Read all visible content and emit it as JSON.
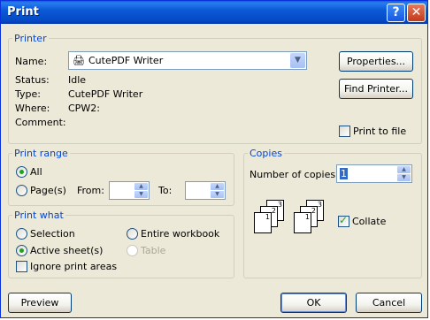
{
  "window": {
    "title": "Print"
  },
  "titlebar": {
    "help_glyph": "?",
    "close_glyph": "✕"
  },
  "printer": {
    "legend": "Printer",
    "name_label": "Name:",
    "name_value": "CutePDF Writer",
    "status_label": "Status:",
    "status_value": "Idle",
    "type_label": "Type:",
    "type_value": "CutePDF Writer",
    "where_label": "Where:",
    "where_value": "CPW2:",
    "comment_label": "Comment:",
    "comment_value": "",
    "properties_button": "Properties...",
    "find_printer_button": "Find Printer...",
    "print_to_file_label": "Print to file",
    "print_to_file_checked": false
  },
  "print_range": {
    "legend": "Print range",
    "all_label": "All",
    "pages_label": "Page(s)",
    "from_label": "From:",
    "to_label": "To:",
    "from_value": "",
    "to_value": "",
    "selected": "all"
  },
  "print_what": {
    "legend": "Print what",
    "selection_label": "Selection",
    "entire_workbook_label": "Entire workbook",
    "active_sheets_label": "Active sheet(s)",
    "table_label": "Table",
    "ignore_print_areas_label": "Ignore print areas",
    "selected": "active_sheets"
  },
  "copies": {
    "legend": "Copies",
    "number_label": "Number of copies:",
    "number_value": "1",
    "collate_label": "Collate",
    "collate_checked": true,
    "collate_icon_pages": [
      "1",
      "2",
      "3"
    ]
  },
  "footer": {
    "preview_button": "Preview",
    "ok_button": "OK",
    "cancel_button": "Cancel"
  }
}
